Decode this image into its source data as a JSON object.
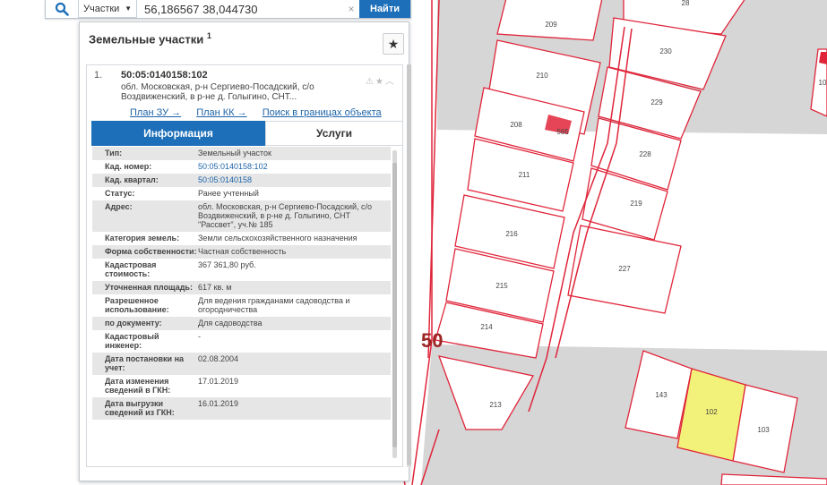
{
  "search": {
    "selector_label": "Участки",
    "query": "56,186567 38,044730",
    "clear_icon": "×",
    "button_label": "Найти"
  },
  "panel": {
    "title": "Земельные участки",
    "title_count": "1",
    "favorite_icon": "★"
  },
  "result": {
    "index": "1.",
    "cadastral_number": "50:05:0140158:102",
    "address_short": "обл. Московская, р-н Сергиево-Посадский, с/о Воздвиженский, в р-не д. Голыгино, СНТ...",
    "action_icons": "⚠★︿",
    "links": [
      "План ЗУ →",
      "План КК →",
      "Поиск в границах объекта →"
    ]
  },
  "tabs": [
    "Информация",
    "Услуги"
  ],
  "info_rows": [
    {
      "label": "Тип:",
      "value": "Земельный участок"
    },
    {
      "label": "Кад. номер:",
      "value": "50:05:0140158:102",
      "link": true
    },
    {
      "label": "Кад. квартал:",
      "value": "50:05:0140158",
      "link": true
    },
    {
      "label": "Статус:",
      "value": "Ранее учтенный"
    },
    {
      "label": "Адрес:",
      "value": "обл. Московская, р-н Сергиево-Посадский, с/о Воздвиженский, в р-не д. Голыгино, СНТ \"Рассвет\", уч.№ 185"
    },
    {
      "label": "Категория земель:",
      "value": "Земли сельскохозяйственного назначения"
    },
    {
      "label": "Форма собственности:",
      "value": "Частная собственность"
    },
    {
      "label": "Кадастровая стоимость:",
      "value": "367 361,80 руб."
    },
    {
      "label": "Уточненная площадь:",
      "value": "617 кв. м"
    },
    {
      "label": "Разрешенное использование:",
      "value": "Для ведения гражданами садоводства и огородничества"
    },
    {
      "label": "по документу:",
      "value": "Для садоводства"
    },
    {
      "label": "Кадастровый инженер:",
      "value": "-"
    },
    {
      "label": "Дата постановки на учет:",
      "value": "02.08.2004"
    },
    {
      "label": "Дата изменения сведений в ГКН:",
      "value": "17.01.2019"
    },
    {
      "label": "Дата выгрузки сведений из ГКН:",
      "value": "16.01.2019"
    }
  ],
  "map": {
    "quarter_label": "50",
    "parcels": [
      "28",
      "209",
      "210",
      "230",
      "229",
      "208",
      "565",
      "228",
      "211",
      "219",
      "216",
      "227",
      "215",
      "214",
      "213",
      "143",
      "102",
      "103",
      "10"
    ],
    "colors": {
      "boundary": "#e0253a",
      "selected_fill": "#f2f27a",
      "block_fill": "#d6d6d6",
      "accent": "#1c6fb8"
    }
  }
}
